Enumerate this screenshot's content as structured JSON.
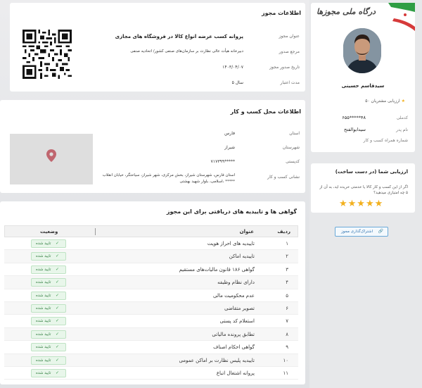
{
  "license": {
    "title": "اطلاعات مجوز",
    "rows": [
      {
        "label": "عنوان مجوز",
        "value": "پروانه کسب عرضه انواع کالا در فروشگاه های مجازی"
      },
      {
        "label": "مرجع صدور",
        "value": "دبیرخانه هیأت عالی نظارت بر سازمان‌های صنفی کشور/ اتحادیه صنفی"
      },
      {
        "label": "تاریخ صدور مجوز",
        "value": "۱۴۰۳/۰۴/۰۷"
      },
      {
        "label": "مدت اعتبار",
        "value": "۵ سال"
      }
    ]
  },
  "business": {
    "title": "اطلاعات محل کسب و کار",
    "rows": [
      {
        "label": "استان",
        "value": "فارس"
      },
      {
        "label": "شهرستان",
        "value": "شیراز"
      },
      {
        "label": "کدپستی",
        "value": "۷۱۷۳۹۹*****"
      },
      {
        "label": "نشانی کسب و کار",
        "value": "استان فارس، شهرستان شیراز، بخش مرکزی، شهر شیراز، سیاحتگر، خیابان انقلاب",
        "value2": "اسلامی، بلوار شهید بهشتی، *****"
      }
    ]
  },
  "certs": {
    "title": "گواهی ها و تاییدیه های دریافتی برای این مجوز",
    "headers": {
      "num": "ردیف",
      "title": "عنوان",
      "status": "وضعیت"
    },
    "rows": [
      {
        "num": "۱",
        "title": "تاییدیه های احراز هویت",
        "status": "تایید شده"
      },
      {
        "num": "۲",
        "title": "تاییدیه اماکن",
        "status": "تایید شده"
      },
      {
        "num": "۳",
        "title": "گواهی ۱۸۶ قانون مالیات‌های مستقیم",
        "status": "تایید شده"
      },
      {
        "num": "۴",
        "title": "دارای نظام وظیفه",
        "status": "تایید شده"
      },
      {
        "num": "۵",
        "title": "عدم محکومیت مالی",
        "status": "تایید شده"
      },
      {
        "num": "۶",
        "title": "تصویر متقاضی",
        "status": "تایید شده"
      },
      {
        "num": "۷",
        "title": "استعلام کد پستی",
        "status": "تایید شده"
      },
      {
        "num": "۸",
        "title": "تطابق پرونده مالیاتی",
        "status": "تایید شده"
      },
      {
        "num": "۹",
        "title": "گواهی احکام اصناف",
        "status": "تایید شده"
      },
      {
        "num": "۱۰",
        "title": "تاییدیه پلیس نظارت بر اماکن عمومی",
        "status": "تایید شده"
      },
      {
        "num": "۱۱",
        "title": "پروانه اشتغال اتباع",
        "status": "تایید شده"
      }
    ]
  },
  "profile": {
    "brand": "درگاه ملی مجوزها",
    "name": "سیدقاسم حسینی",
    "rating_label": "ارزیابی مشتریان ۵۰",
    "rows": [
      {
        "label": "کدملی",
        "value": "۶۵۵*****۴۸"
      },
      {
        "label": "نام پدر",
        "value": "سیدابوالفتح"
      },
      {
        "label": "شماره همراه کسب و کار",
        "value": ""
      }
    ]
  },
  "rate": {
    "title": "ارزیابی شما (در دست ساخت)",
    "question": "اگر از این کسب و کار کالا یا خدمتی خریده اید، به آن از ۵ چه امتیازی میدهید؟",
    "stars": "★★★★★"
  },
  "share": {
    "label": "اشتراک‌گذاری مجوز"
  },
  "colors": {
    "accent": "#f2b01e",
    "verified": "#2b7a3a",
    "pin": "#c0666f"
  }
}
